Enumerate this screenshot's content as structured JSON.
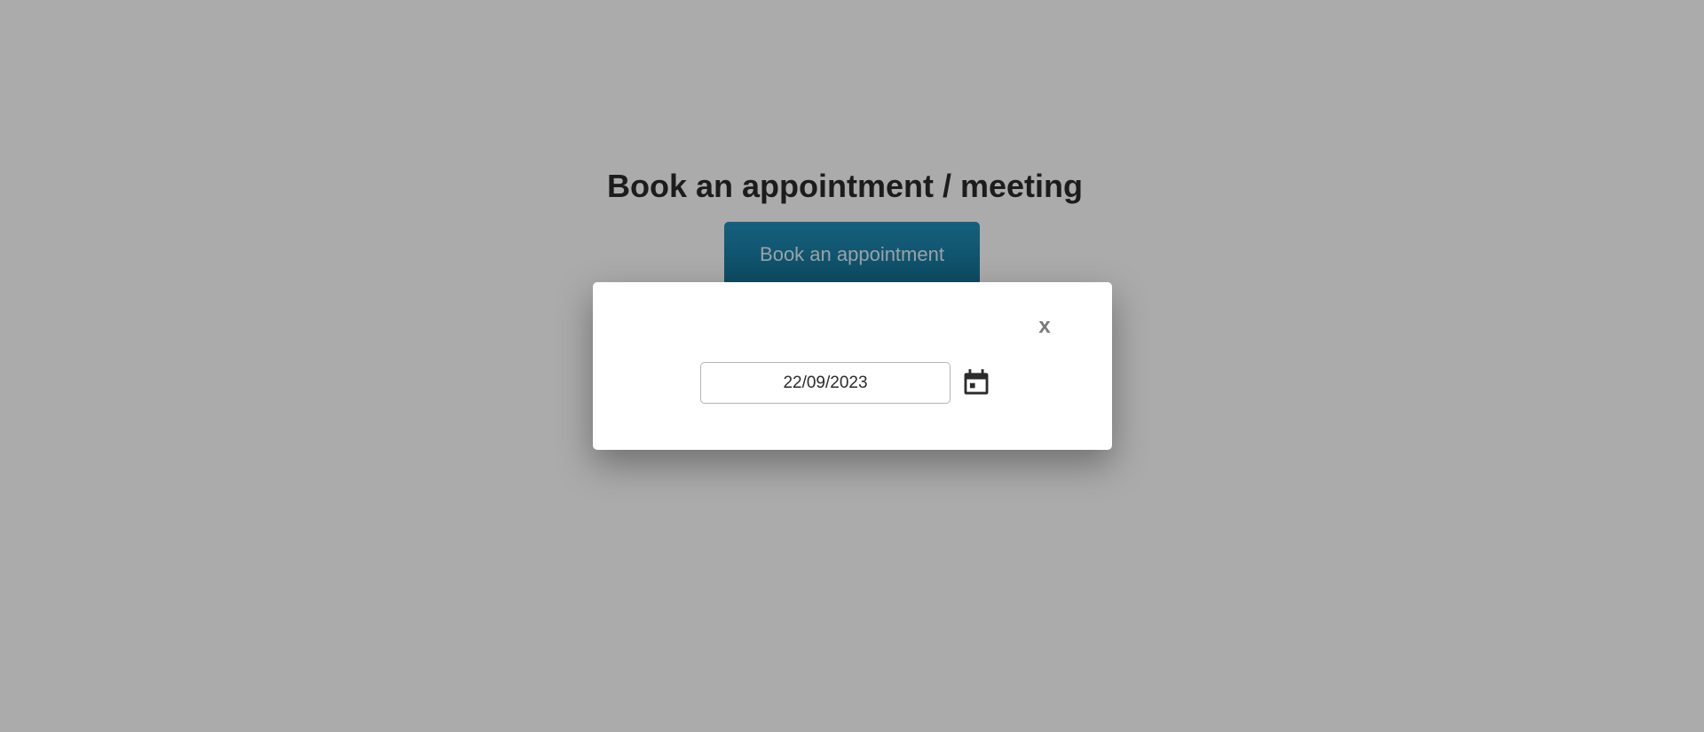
{
  "page": {
    "title": "Book an appointment / meeting",
    "book_button_label": "Book an appointment"
  },
  "modal": {
    "close_label": "x",
    "date_value": "22/09/2023",
    "calendar_icon": "calendar-icon"
  },
  "colors": {
    "button_top": "#1e8fbb",
    "button_bottom": "#156f91",
    "overlay": "rgba(0,0,0,0.33)",
    "modal_bg": "#ffffff",
    "title_text": "#2b2b2b"
  }
}
